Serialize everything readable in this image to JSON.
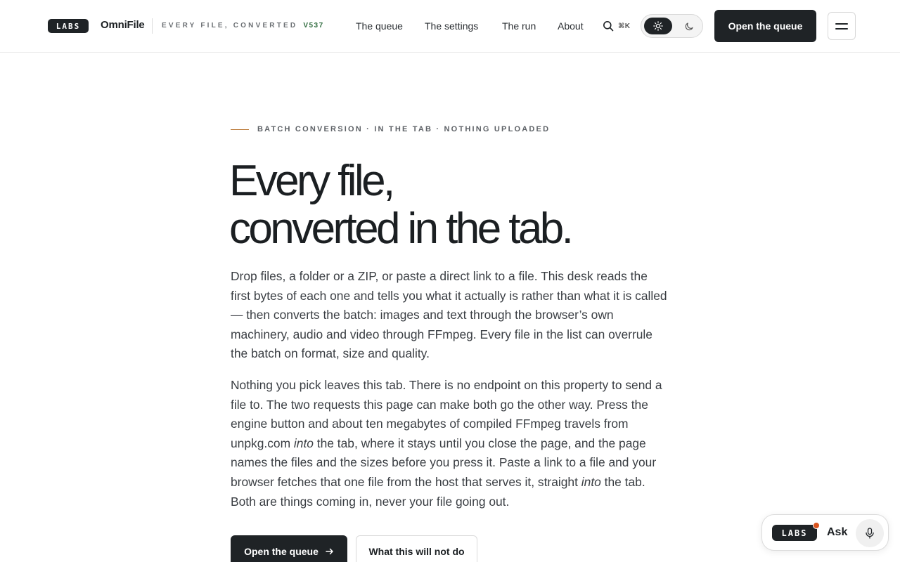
{
  "header": {
    "logo_text": "LABS",
    "brand": "OmniFile",
    "tagline": "EVERY FILE, CONVERTED",
    "version": "V537",
    "nav": [
      "The queue",
      "The settings",
      "The run",
      "About"
    ],
    "search_shortcut": "⌘K",
    "theme_toggle": {
      "active": "light",
      "options": [
        "light",
        "dark"
      ]
    },
    "cta_label": "Open the queue",
    "icons": [
      "search-icon",
      "sun-icon",
      "moon-icon",
      "hamburger-menu-icon"
    ]
  },
  "hero": {
    "eyebrow": "BATCH CONVERSION · IN THE TAB · NOTHING UPLOADED",
    "headline_line1": "Every file,",
    "headline_line2": "converted in the tab.",
    "paragraph1": "Drop files, a folder or a ZIP, or paste a direct link to a file. This desk reads the first bytes of each one and tells you what it actually is rather than what it is called — then converts the batch: images and text through the browser’s own machinery, audio and video through FFmpeg. Every file in the list can overrule the batch on format, size and quality.",
    "paragraph2": {
      "part1": "Nothing you pick leaves this tab. There is no endpoint on this property to send a file to. The two requests this page can make both go the other way. Press the engine button and about ten megabytes of compiled FFmpeg travels from unpkg.com ",
      "em1": "into",
      "part2": " the tab, where it stays until you close the page, and the page names the files and the sizes before you press it. Paste a link to a file and your browser fetches that one file from the host that serves it, straight ",
      "em2": "into",
      "part3": " the tab. Both are things coming in, never your file going out."
    },
    "primary_button": "Open the queue",
    "secondary_button": "What this will not do"
  },
  "ask_widget": {
    "logo_text": "LABS",
    "label": "Ask",
    "notification_color": "#d9531e"
  },
  "colors": {
    "ink": "#1f2326",
    "accent_rule": "#b8732e",
    "version_green": "#2f6b3e"
  }
}
